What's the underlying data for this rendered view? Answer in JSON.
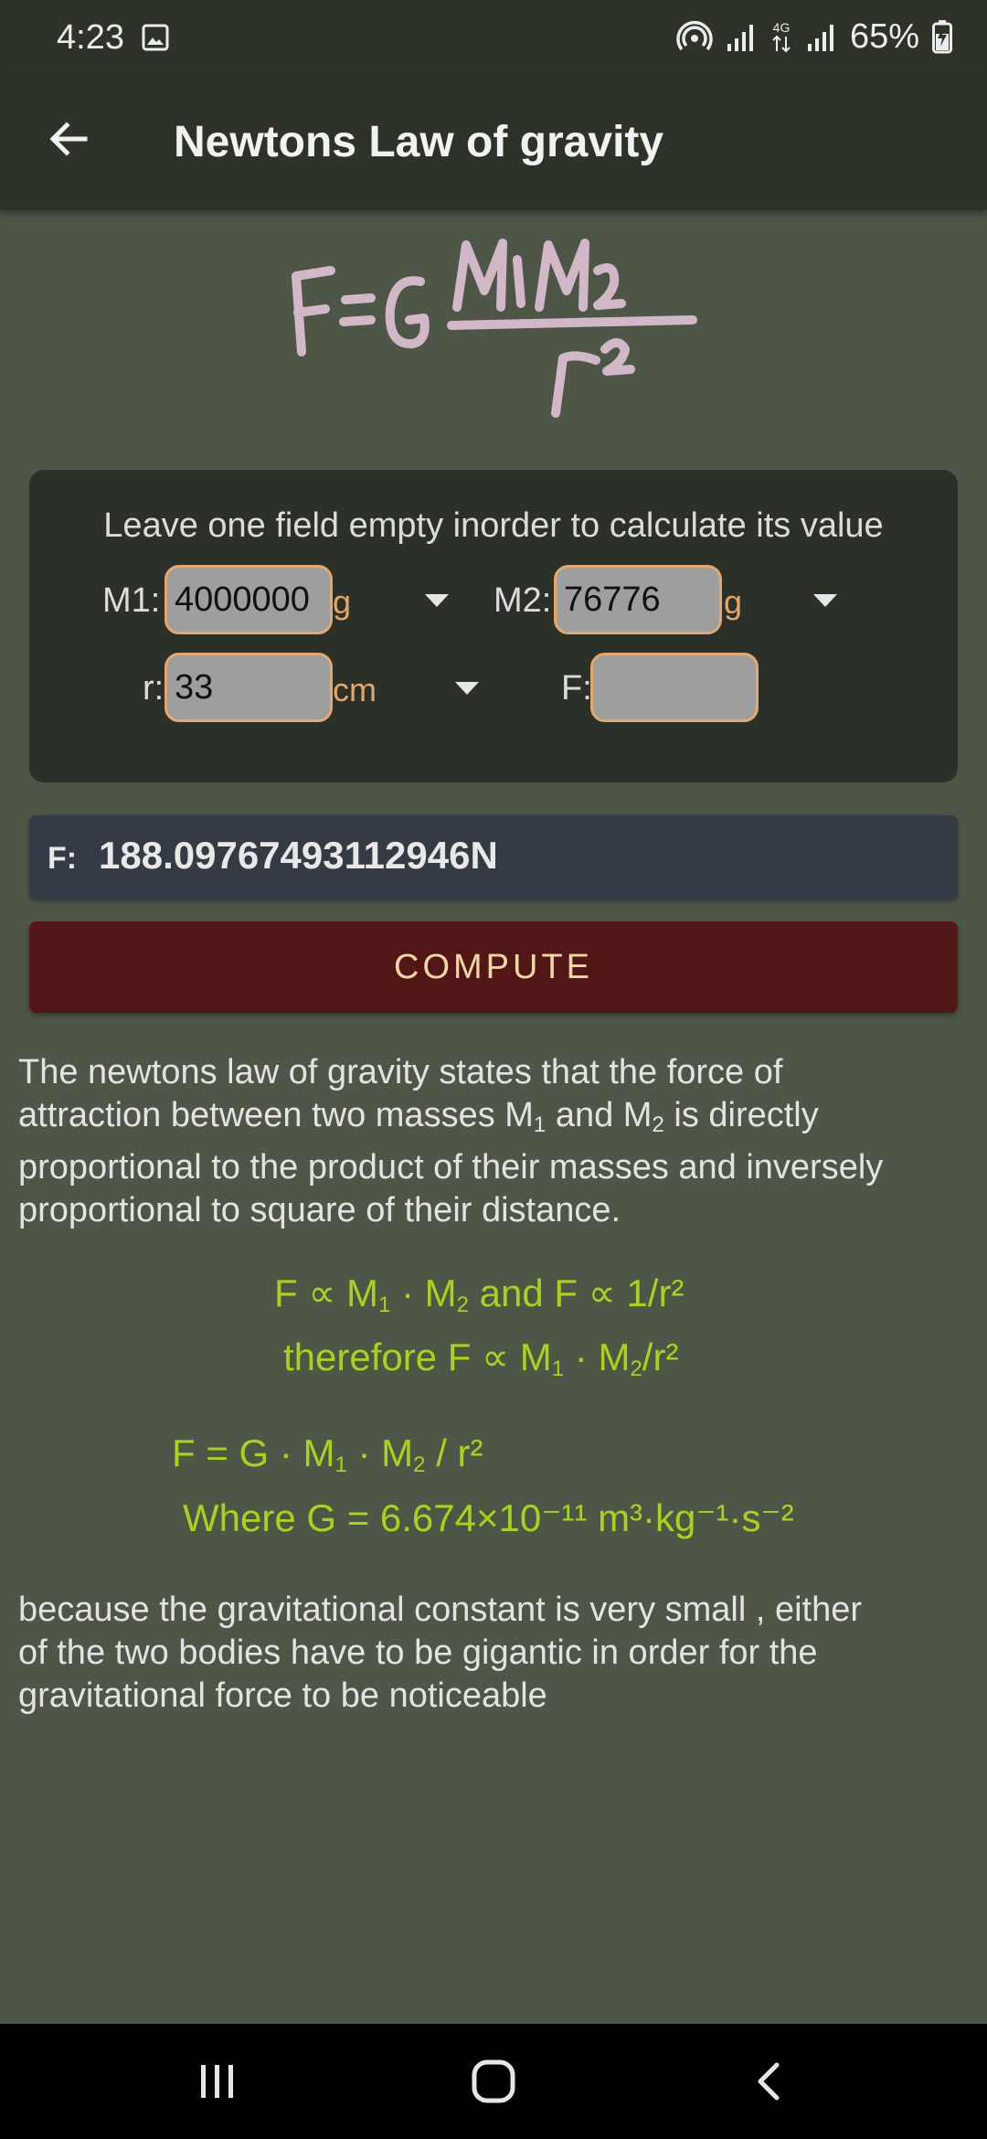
{
  "status_bar": {
    "time": "4:23",
    "battery": "65%"
  },
  "app_bar": {
    "title": "Newtons Law of gravity"
  },
  "card": {
    "hint": "Leave one field empty inorder to calculate its value",
    "m1": {
      "label": "M1:",
      "value": "4000000",
      "unit": "g"
    },
    "m2": {
      "label": "M2:",
      "value": "76776",
      "unit": "g"
    },
    "r": {
      "label": "r:",
      "value": "33",
      "unit": "cm"
    },
    "f": {
      "label": "F:",
      "value": ""
    }
  },
  "result": {
    "label": "F:",
    "value": "188.09767493112946N"
  },
  "compute_label": "COMPUTE",
  "paragraph1": {
    "l1": "The newtons law of gravity states that the force of",
    "l2a": "attraction between two masses M",
    "s1": "1",
    "l2b": " and M",
    "s2": "2",
    "l2c": " is directly",
    "l3": "proportional to the product of their masses and inversely",
    "l4": "proportional to square of their distance."
  },
  "eq1": {
    "a": "F ∝ M",
    "s1": "1",
    "b": " · M",
    "s2": "2",
    "c": " and F ∝ 1/r²"
  },
  "eq2": {
    "a": "therefore F ∝ M",
    "s1": "1",
    "b": " · M",
    "s2": "2",
    "c": "/r²"
  },
  "eq3": {
    "a": "F = G · M",
    "s1": "1",
    "b": " · M",
    "s2": "2",
    "c": " / r²"
  },
  "eq4": "Where G = 6.674×10⁻¹¹ m³·kg⁻¹·s⁻²",
  "paragraph2": {
    "l1": "because the gravitational constant is very small , either",
    "l2": "of the two bodies have to be gigantic in order for the",
    "l3": "gravitational force to be noticeable"
  },
  "colors": {
    "accent_border": "#e4a86d",
    "compute_bg": "#531616",
    "formula_green": "#a7d31c",
    "formula_image": "#d2b7c8"
  }
}
